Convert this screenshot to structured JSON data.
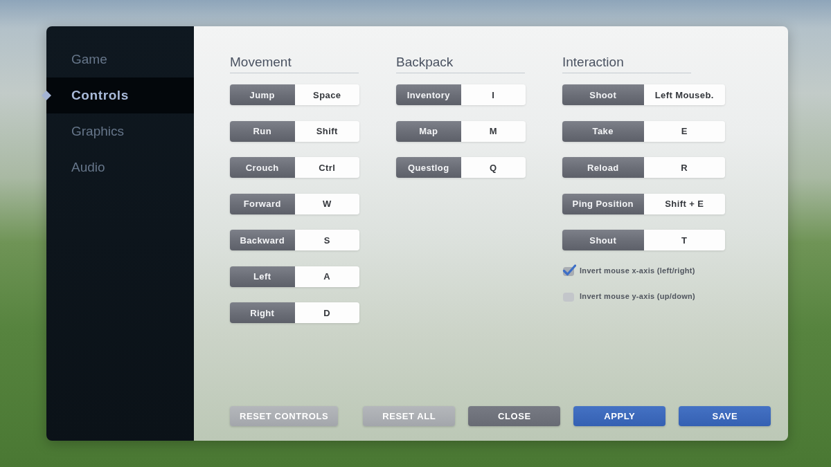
{
  "sidebar": {
    "items": [
      {
        "label": "Game",
        "selected": false
      },
      {
        "label": "Controls",
        "selected": true
      },
      {
        "label": "Graphics",
        "selected": false
      },
      {
        "label": "Audio",
        "selected": false
      }
    ]
  },
  "sections": [
    {
      "title": "Movement",
      "bindings": [
        {
          "action": "Jump",
          "key": "Space"
        },
        {
          "action": "Run",
          "key": "Shift"
        },
        {
          "action": "Crouch",
          "key": "Ctrl"
        },
        {
          "action": "Forward",
          "key": "W"
        },
        {
          "action": "Backward",
          "key": "S"
        },
        {
          "action": "Left",
          "key": "A"
        },
        {
          "action": "Right",
          "key": "D"
        }
      ]
    },
    {
      "title": "Backpack",
      "bindings": [
        {
          "action": "Inventory",
          "key": "I"
        },
        {
          "action": "Map",
          "key": "M"
        },
        {
          "action": "Questlog",
          "key": "Q"
        }
      ]
    },
    {
      "title": "Interaction",
      "bindings": [
        {
          "action": "Shoot",
          "key": "Left Mouseb."
        },
        {
          "action": "Take",
          "key": "E"
        },
        {
          "action": "Reload",
          "key": "R"
        },
        {
          "action": "Ping Position",
          "key": "Shift + E"
        },
        {
          "action": "Shout",
          "key": "T"
        }
      ],
      "options": [
        {
          "label": "Invert mouse x-axis (left/right)",
          "checked": true
        },
        {
          "label": "Invert mouse y-axis (up/down)",
          "checked": false
        }
      ]
    }
  ],
  "buttons": [
    {
      "label": "RESET CONTROLS",
      "kind": "light"
    },
    {
      "label": "RESET ALL",
      "kind": "light"
    },
    {
      "label": "CLOSE",
      "kind": "dark"
    },
    {
      "label": "APPLY",
      "kind": "primary"
    },
    {
      "label": "SAVE",
      "kind": "primary"
    }
  ]
}
